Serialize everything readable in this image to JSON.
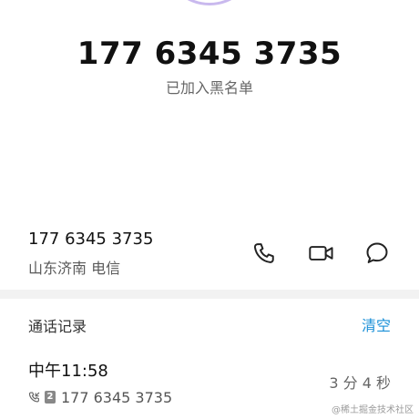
{
  "header": {
    "phone_number": "177 6345 3735",
    "status": "已加入黑名单"
  },
  "contact": {
    "number": "177 6345 3735",
    "location": "山东济南 电信",
    "actions": [
      {
        "icon": "phone-icon"
      },
      {
        "icon": "video-camera-icon"
      },
      {
        "icon": "message-bubble-icon"
      }
    ]
  },
  "call_log": {
    "title": "通话记录",
    "clear_label": "清空",
    "records": [
      {
        "time": "中午11:58",
        "sim": "2",
        "number": "177 6345 3735",
        "duration": "3 分 4 秒"
      }
    ]
  },
  "watermark": "@稀土掘金技术社区",
  "colors": {
    "accent": "#1a90d8",
    "avatar_ring": "#c9b9ee",
    "divider": "#f2f2f2"
  }
}
